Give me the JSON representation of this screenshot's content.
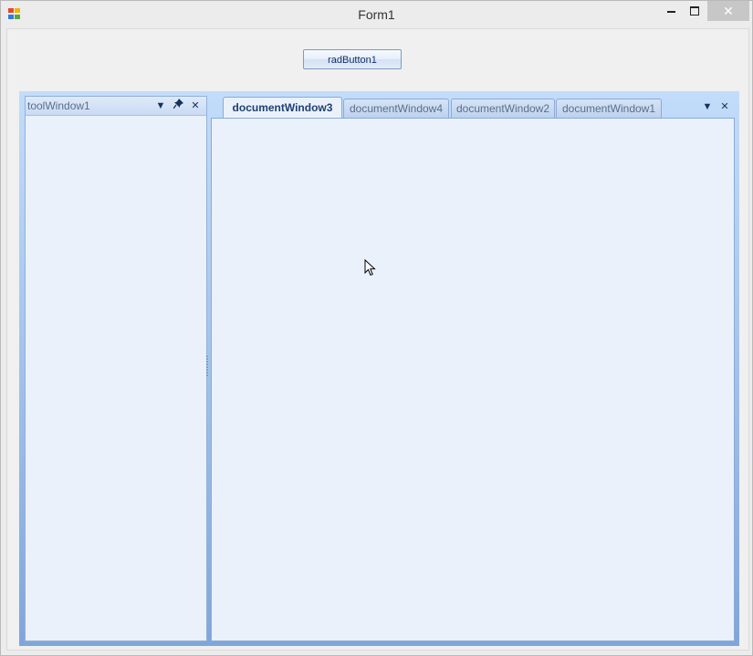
{
  "window": {
    "title": "Form1",
    "controls": {
      "minimize": "minimize",
      "maximize": "maximize",
      "close": "✕"
    }
  },
  "form": {
    "button_label": "radButton1"
  },
  "tool_window": {
    "title": "toolWindow1",
    "buttons": {
      "menu": "▼",
      "pin": "📌",
      "close": "✕"
    }
  },
  "document_tabs": {
    "tabs": [
      {
        "label": "documentWindow3",
        "active": true
      },
      {
        "label": "documentWindow4",
        "active": false
      },
      {
        "label": "documentWindow2",
        "active": false
      },
      {
        "label": "documentWindow1",
        "active": false
      }
    ],
    "buttons": {
      "menu": "▼",
      "close": "✕"
    }
  },
  "icons": [
    "app-icon",
    "minimize-icon",
    "maximize-icon",
    "close-icon",
    "dropdown-arrow-icon",
    "pin-icon",
    "mouse-cursor-icon"
  ],
  "colors": {
    "accent": "#7fa6db",
    "panel": "#eaf1fa",
    "close_hover": "#c7c7c7"
  }
}
